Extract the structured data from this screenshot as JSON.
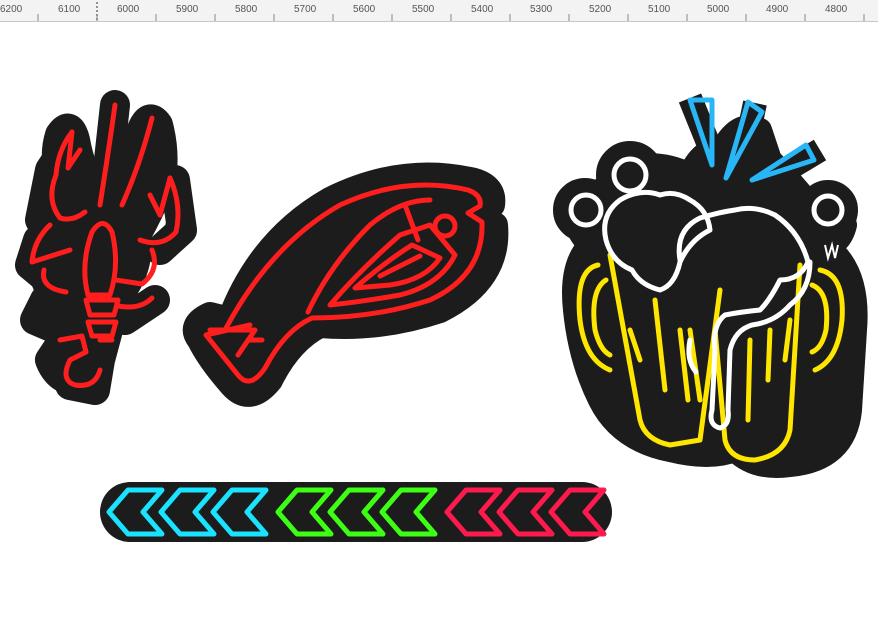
{
  "ruler": {
    "labels": [
      "6200",
      "6100",
      "6000",
      "5900",
      "5800",
      "5700",
      "5600",
      "5500",
      "5400",
      "5300",
      "5200",
      "5100",
      "5000",
      "4900",
      "4800"
    ]
  },
  "artwork": {
    "items": [
      {
        "name": "neon lobster",
        "color": "#ff1e1e"
      },
      {
        "name": "neon fish",
        "color": "#ff1e1e"
      },
      {
        "name": "neon beer mugs",
        "colors": [
          "#ffe600",
          "#ffffff",
          "#29b6f6"
        ]
      },
      {
        "name": "neon chevron arrows",
        "colors": [
          "#19e3ff",
          "#3dff14",
          "#ff1a4d"
        ]
      }
    ],
    "backing_color": "#1c1c1c"
  }
}
